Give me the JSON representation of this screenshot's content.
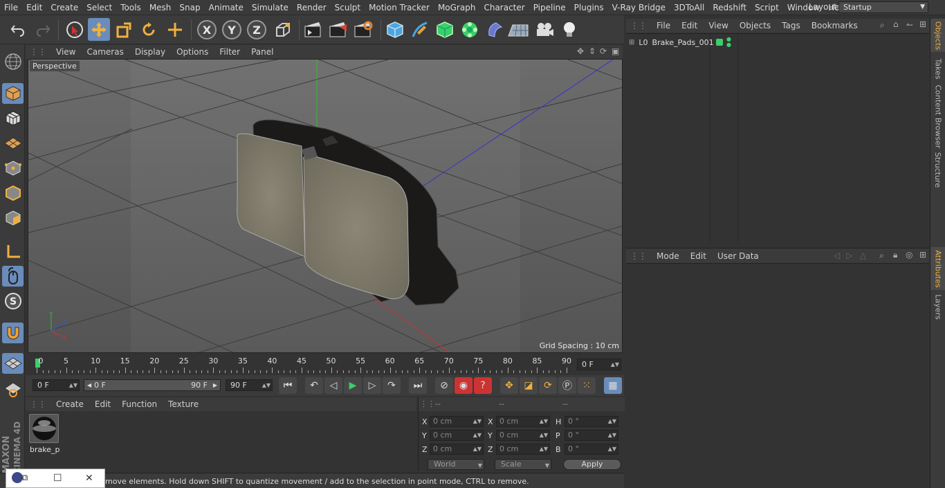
{
  "menubar": {
    "items": [
      "File",
      "Edit",
      "Create",
      "Select",
      "Tools",
      "Mesh",
      "Snap",
      "Animate",
      "Simulate",
      "Render",
      "Sculpt",
      "Motion Tracker",
      "MoGraph",
      "Character",
      "Pipeline",
      "Plugins",
      "V-Ray Bridge",
      "3DToAll",
      "Redshift",
      "Script",
      "Window",
      "Help"
    ],
    "layout_label": "Layout:",
    "layout_value": "Startup"
  },
  "toolbar": {
    "x_label": "X",
    "y_label": "Y",
    "z_label": "Z"
  },
  "viewport": {
    "menu": [
      "View",
      "Cameras",
      "Display",
      "Options",
      "Filter",
      "Panel"
    ],
    "camera_label": "Perspective",
    "grid_spacing": "Grid Spacing : 10 cm"
  },
  "timeline": {
    "ticks": [
      "0",
      "5",
      "10",
      "15",
      "20",
      "25",
      "30",
      "35",
      "40",
      "45",
      "50",
      "55",
      "60",
      "65",
      "70",
      "75",
      "80",
      "85",
      "90"
    ],
    "current_frame": "0 F"
  },
  "transport": {
    "start_field": "0 F",
    "range_start": "0 F",
    "range_end": "90 F",
    "end_field": "90 F"
  },
  "materials": {
    "menu": [
      "Create",
      "Edit",
      "Function",
      "Texture"
    ],
    "items": [
      {
        "name": "brake_p"
      }
    ]
  },
  "coordinates": {
    "header": [
      "--",
      "--",
      "--"
    ],
    "rows": [
      {
        "l1": "X",
        "v1": "0 cm",
        "l2": "X",
        "v2": "0 cm",
        "l3": "H",
        "v3": "0 °"
      },
      {
        "l1": "Y",
        "v1": "0 cm",
        "l2": "Y",
        "v2": "0 cm",
        "l3": "P",
        "v3": "0 °"
      },
      {
        "l1": "Z",
        "v1": "0 cm",
        "l2": "Z",
        "v2": "0 cm",
        "l3": "B",
        "v3": "0 °"
      }
    ],
    "space_dropdown": "World",
    "mode_dropdown": "Scale",
    "apply_label": "Apply"
  },
  "status": {
    "text": "move elements. Hold down SHIFT to quantize movement / add to the selection in point mode, CTRL to remove."
  },
  "objects": {
    "menu": [
      "File",
      "Edit",
      "View",
      "Objects",
      "Tags",
      "Bookmarks"
    ],
    "items": [
      {
        "name": "Brake_Pads_001"
      }
    ]
  },
  "attributes": {
    "menu": [
      "Mode",
      "Edit",
      "User Data"
    ]
  },
  "right_tabs": [
    "Objects",
    "Takes",
    "Content Browser",
    "Structure",
    "Attributes",
    "Layers"
  ],
  "brand": {
    "maxon": "MAXON",
    "cinema": "CINEMA 4D"
  },
  "colors": {
    "accent": "#6a8cba",
    "axis_x": "#cc3333",
    "axis_y": "#33bb33",
    "axis_z": "#3333cc",
    "active_tab": "#f0b040"
  }
}
